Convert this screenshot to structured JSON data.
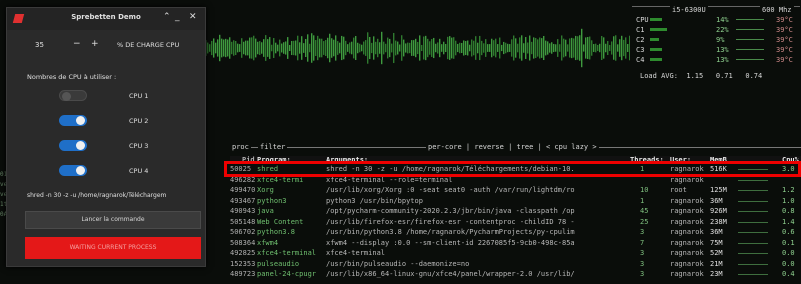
{
  "window": {
    "title": "Sprebetten Demo",
    "percent_value": "35",
    "minus": "−",
    "plus": "+",
    "percent_label": "% DE CHARGE CPU",
    "cpu_question": "Nombres de CPU à utiliser :",
    "cpus": [
      {
        "label": "CPU 1",
        "enabled": false
      },
      {
        "label": "CPU 2",
        "enabled": true
      },
      {
        "label": "CPU 3",
        "enabled": true
      },
      {
        "label": "CPU 4",
        "enabled": true
      }
    ],
    "command_text": "shred -n 30 -z -u /home/ragnarok/Téléchargem",
    "launch_button": "Lancer la commande",
    "waiting_button": "WAITING CURRENT PROCESS",
    "title_buttons": [
      "⌃",
      "_",
      "✕"
    ]
  },
  "cpu_panel": {
    "model": "i5-6300U",
    "freq": "600 Mhz",
    "rows": [
      {
        "name": "CPU",
        "percent": "14%",
        "temp": "39°C",
        "level": 0.14
      },
      {
        "name": "C1",
        "percent": "22%",
        "temp": "39°C",
        "level": 0.22
      },
      {
        "name": "C2",
        "percent": "9%",
        "temp": "39°C",
        "level": 0.09
      },
      {
        "name": "C3",
        "percent": "13%",
        "temp": "39°C",
        "level": 0.13
      },
      {
        "name": "C4",
        "percent": "13%",
        "temp": "39°C",
        "level": 0.13
      }
    ],
    "load_avg": "Load AVG:  1.15   0.71   0.74"
  },
  "proc": {
    "tab_left": "proc",
    "tab_filter": "filter",
    "tab_right": "per-core | reverse | tree | < cpu lazy >",
    "headers": {
      "pid": "Pid",
      "program": "Program:",
      "args": "Arguments:",
      "threads": "Threads:",
      "user": "User:",
      "mem": "MemB",
      "cpu": "Cpu%"
    },
    "rows": [
      {
        "pid": "50025",
        "program": "shred",
        "args": "shred -n 30 -z -u /home/ragnarok/Téléchargements/debian-10.",
        "threads": "1",
        "user": "ragnarok",
        "mem": "516K",
        "cpu": "3.0"
      },
      {
        "pid": "496282",
        "program": "xfce4-termi",
        "args": "xfce4-terminal --role=terminal",
        "threads": "",
        "user": "ragnarok",
        "mem": "",
        "cpu": ""
      },
      {
        "pid": "499470",
        "program": "Xorg",
        "args": "/usr/lib/xorg/Xorg :0 -seat seat0 -auth /var/run/lightdm/ro",
        "threads": "10",
        "user": "root",
        "mem": "125M",
        "cpu": "1.2"
      },
      {
        "pid": "493467",
        "program": "python3",
        "args": "python3 /usr/bin/bpytop",
        "threads": "1",
        "user": "ragnarok",
        "mem": "36M",
        "cpu": "1.0"
      },
      {
        "pid": "490943",
        "program": "java",
        "args": "/opt/pycharm-community-2020.2.3/jbr/bin/java -classpath /op",
        "threads": "45",
        "user": "ragnarok",
        "mem": "926M",
        "cpu": "0.8"
      },
      {
        "pid": "505148",
        "program": "Web Content",
        "args": "/usr/lib/firefox-esr/firefox-esr -contentproc -childID 78 -",
        "threads": "25",
        "user": "ragnarok",
        "mem": "238M",
        "cpu": "1.4"
      },
      {
        "pid": "506702",
        "program": "python3.8",
        "args": "/usr/bin/python3.8 /home/ragnarok/PycharmProjects/py-cpulim",
        "threads": "3",
        "user": "ragnarok",
        "mem": "36M",
        "cpu": "0.6"
      },
      {
        "pid": "508364",
        "program": "xfwm4",
        "args": "xfwm4 --display :0.0 --sm-client-id 2267085f5-9cb0-498c-85a",
        "threads": "7",
        "user": "ragnarok",
        "mem": "75M",
        "cpu": "0.1"
      },
      {
        "pid": "492825",
        "program": "xfce4-terminal",
        "args": "xfce4-terminal",
        "threads": "3",
        "user": "ragnarok",
        "mem": "52M",
        "cpu": "0.0"
      },
      {
        "pid": "152353",
        "program": "pulseaudio",
        "args": "/usr/bin/pulseaudio --daemonize=no",
        "threads": "3",
        "user": "ragnarok",
        "mem": "21M",
        "cpu": "0.0"
      },
      {
        "pid": "489723",
        "program": "panel-24-cpugr",
        "args": "/usr/lib/x86_64-linux-gnu/xfce4/panel/wrapper-2.0 /usr/lib/",
        "threads": "3",
        "user": "ragnarok",
        "mem": "23M",
        "cpu": "0.4"
      }
    ]
  },
  "side_labels": [
    "01",
    "ve",
    "ve",
    "1t",
    "0A"
  ]
}
